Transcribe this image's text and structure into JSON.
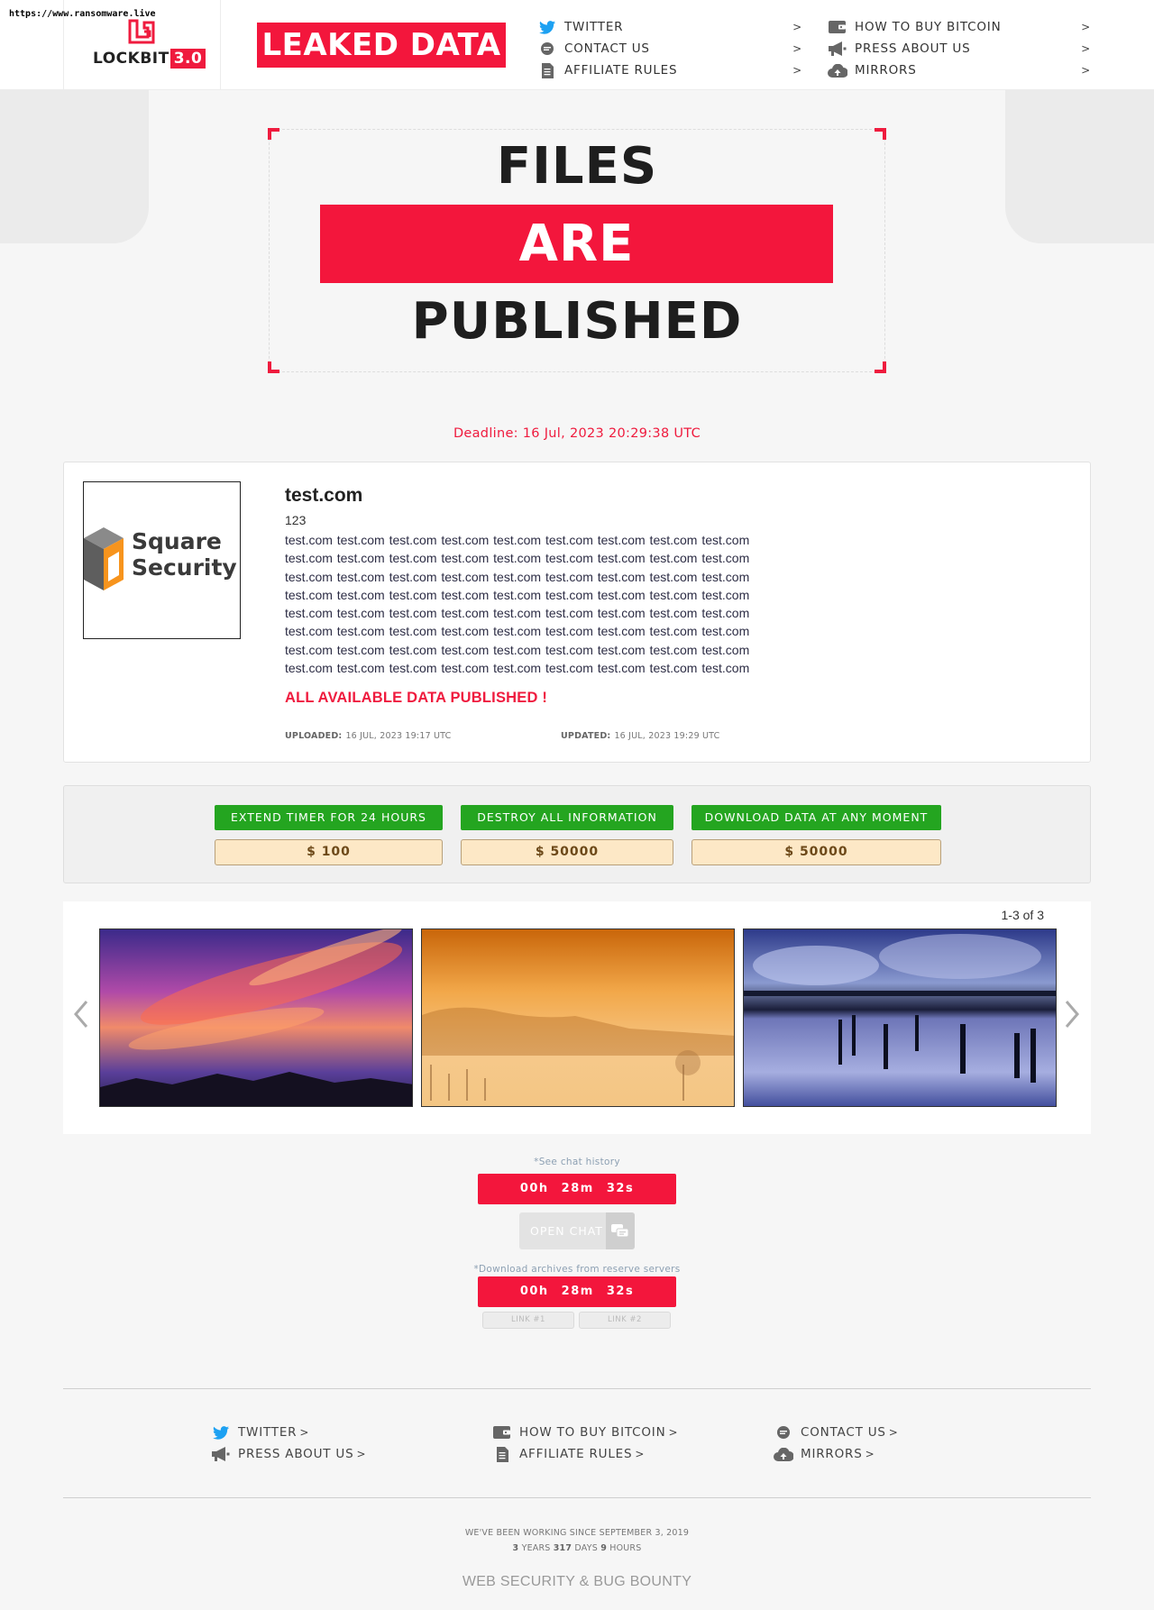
{
  "watermark": "https://www.ransomware.live",
  "brand": {
    "name": "LOCKBIT",
    "version": "3.0",
    "badge": "LEAKED DATA"
  },
  "nav": {
    "col1": [
      {
        "label": "TWITTER",
        "icon": "twitter-icon"
      },
      {
        "label": "CONTACT US",
        "icon": "chat-icon"
      },
      {
        "label": "AFFILIATE RULES",
        "icon": "document-icon"
      }
    ],
    "col2": [
      {
        "label": "HOW TO BUY BITCOIN",
        "icon": "wallet-icon"
      },
      {
        "label": "PRESS ABOUT US",
        "icon": "megaphone-icon"
      },
      {
        "label": "MIRRORS",
        "icon": "cloud-icon"
      }
    ],
    "chevron": ">"
  },
  "hero": {
    "line1": "FILES",
    "line2": "ARE",
    "line3": "PUBLISHED"
  },
  "deadline": "Deadline: 16 Jul, 2023 20:29:38 UTC",
  "post": {
    "title": "test.com",
    "subtitle": "123",
    "description_lines": [
      "test.com test.com test.com test.com test.com test.com test.com test.com test.com",
      "test.com test.com test.com test.com test.com test.com test.com test.com test.com",
      "test.com test.com test.com test.com test.com test.com test.com test.com test.com",
      "test.com test.com test.com test.com test.com test.com test.com test.com test.com",
      "test.com test.com test.com test.com test.com test.com test.com test.com test.com",
      "test.com test.com test.com test.com test.com test.com test.com test.com test.com",
      "test.com test.com test.com test.com test.com test.com test.com test.com test.com",
      "test.com test.com test.com test.com test.com test.com test.com test.com test.com"
    ],
    "status": "ALL AVAILABLE DATA PUBLISHED !",
    "uploaded_label": "UPLOADED:",
    "uploaded_value": "16 JUL, 2023 19:17 UTC",
    "updated_label": "UPDATED:",
    "updated_value": "16 JUL, 2023 19:29 UTC",
    "logo_text_line1": "Square",
    "logo_text_line2": "Security"
  },
  "options": [
    {
      "action": "EXTEND TIMER FOR 24 HOURS",
      "price": "$ 100"
    },
    {
      "action": "DESTROY ALL INFORMATION",
      "price": "$ 50000"
    },
    {
      "action": "DOWNLOAD DATA AT ANY MOMENT",
      "price": "$ 50000"
    }
  ],
  "gallery": {
    "count": "1-3 of 3"
  },
  "chat": {
    "history_note": "*See chat history",
    "timer": "00h 28m 32s",
    "open_chat": "OPEN CHAT",
    "download_note": "*Download archives from reserve servers",
    "timer2": "00h 28m 32s",
    "link1": "LINK #1",
    "link2": "LINK #2"
  },
  "footer": {
    "items": [
      {
        "label": "TWITTER",
        "icon": "twitter-icon"
      },
      {
        "label": "PRESS ABOUT US",
        "icon": "megaphone-icon"
      },
      {
        "label": "HOW TO BUY BITCOIN",
        "icon": "wallet-icon"
      },
      {
        "label": "AFFILIATE RULES",
        "icon": "document-icon"
      },
      {
        "label": "CONTACT US",
        "icon": "chat-icon"
      },
      {
        "label": "MIRRORS",
        "icon": "cloud-icon"
      }
    ],
    "since_text": "WE'VE BEEN WORKING SINCE SEPTEMBER 3, 2019",
    "years": "3",
    "years_label": "YEARS",
    "days": "317",
    "days_label": "DAYS",
    "hours": "9",
    "hours_label": "HOURS",
    "tagline": "WEB SECURITY & BUG BOUNTY"
  },
  "colors": {
    "accent": "#f3163c",
    "green": "#24a520",
    "price_bg": "#fde8c6",
    "twitter": "#1da1f2"
  }
}
